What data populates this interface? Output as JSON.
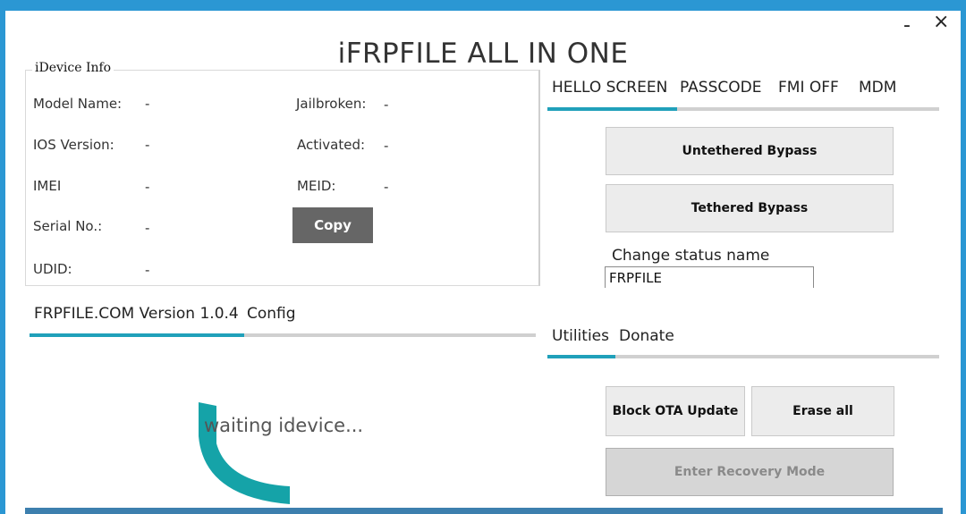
{
  "window": {
    "title": "iFRPFILE ALL IN ONE",
    "minimize_label": "-",
    "close_label": "×"
  },
  "device_info": {
    "group_title": "iDevice Info",
    "model_name_label": "Model Name:",
    "model_name_value": "-",
    "ios_version_label": "IOS Version:",
    "ios_version_value": "-",
    "imei_label": "IMEI",
    "imei_value": "-",
    "serial_label": "Serial No.:",
    "serial_value": "-",
    "udid_label": "UDID:",
    "udid_value": "-",
    "jailbroken_label": "Jailbroken:",
    "jailbroken_value": "-",
    "activated_label": "Activated:",
    "activated_value": "-",
    "meid_label": "MEID:",
    "meid_value": "-",
    "copy_label": "Copy"
  },
  "bypass_tabs": {
    "items": [
      "HELLO SCREEN",
      "PASSCODE",
      "FMI OFF",
      "MDM"
    ],
    "selected": "HELLO SCREEN"
  },
  "bypass": {
    "untethered_label": "Untethered Bypass",
    "tethered_label": "Tethered Bypass",
    "status_name_label": "Change status name",
    "status_name_value": "FRPFILE"
  },
  "version_tabs": {
    "items": [
      "FRPFILE.COM Version 1.0.4",
      "Config"
    ],
    "selected": "FRPFILE.COM Version 1.0.4"
  },
  "status": {
    "waiting_text": "waiting idevice..."
  },
  "utility_tabs": {
    "items": [
      "Utilities",
      "Donate"
    ],
    "selected": "Utilities"
  },
  "utilities": {
    "block_ota_label": "Block OTA Update",
    "erase_all_label": "Erase all",
    "recovery_label": "Enter Recovery Mode"
  },
  "colors": {
    "accent": "#20a0ba",
    "window_border": "#2b97d3",
    "spinner": "#15a3a8"
  }
}
